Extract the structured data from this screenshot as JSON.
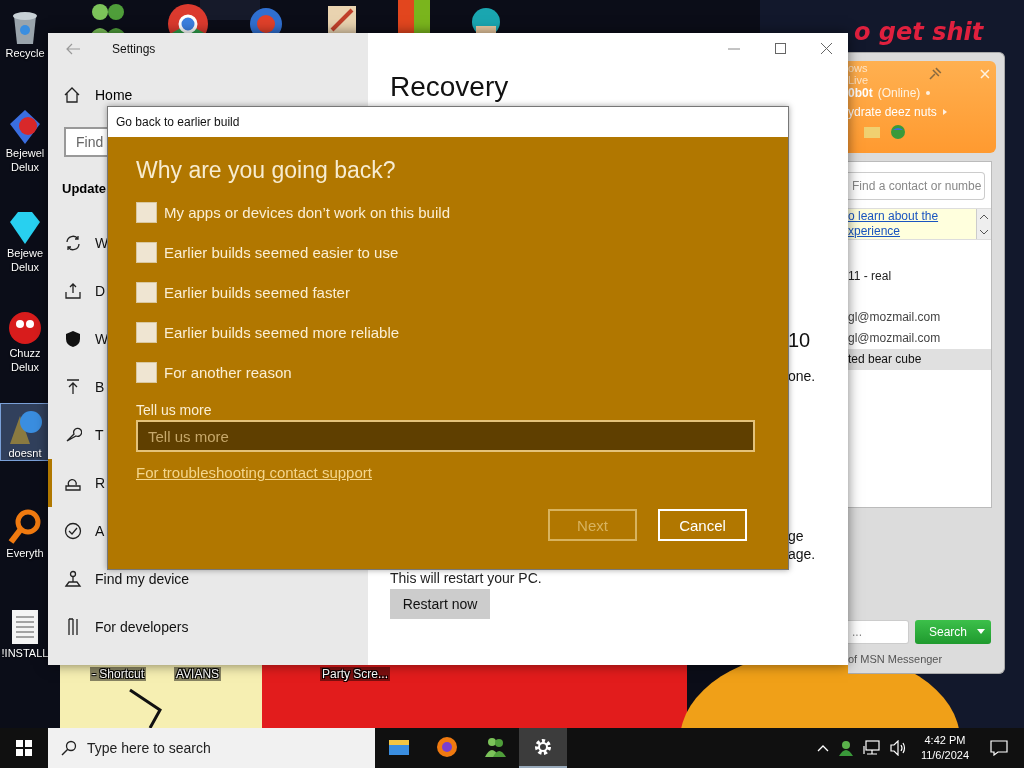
{
  "desktop": {
    "banner_text": "o get shit",
    "icons": [
      {
        "label": "Recycle",
        "selected": false
      },
      {
        "label": "Bejewel Delux",
        "selected": false
      },
      {
        "label": "Bejewe Delux",
        "selected": false
      },
      {
        "label": "Chuzz Delux",
        "selected": false
      },
      {
        "label": "doesnt",
        "selected": true
      },
      {
        "label": "Everyth",
        "selected": false
      },
      {
        "label": "!INSTALL",
        "selected": false
      }
    ],
    "bottom_labels": [
      "- Shortcut",
      "AVIANS",
      "Party Scre..."
    ]
  },
  "settings": {
    "title": "Settings",
    "home": "Home",
    "search_placeholder": "Find",
    "section": "Update",
    "nav": [
      {
        "label": "W",
        "selected": false
      },
      {
        "label": "D",
        "selected": false
      },
      {
        "label": "W",
        "selected": false
      },
      {
        "label": "B",
        "selected": false
      },
      {
        "label": "T",
        "selected": false
      },
      {
        "label": "R",
        "selected": true
      },
      {
        "label": "A",
        "selected": false
      },
      {
        "label": "Find my device",
        "selected": false
      },
      {
        "label": "For developers",
        "selected": false
      }
    ],
    "page_title": "Recovery",
    "fragment_1": "10",
    "fragment_2": "one.",
    "fragment_3": "ge",
    "fragment_4": "age.",
    "restart_note": "This will restart your PC.",
    "restart_button": "Restart now"
  },
  "dialog": {
    "title": "Go back to earlier build",
    "heading": "Why are you going back?",
    "reasons": [
      {
        "label": "My apps or devices don’t work on this build",
        "checked": false
      },
      {
        "label": "Earlier builds seemed easier to use",
        "checked": false
      },
      {
        "label": "Earlier builds seemed faster",
        "checked": false
      },
      {
        "label": "Earlier builds seemed more reliable",
        "checked": false
      },
      {
        "label": "For another reason",
        "checked": false
      }
    ],
    "more_label": "Tell us more",
    "more_placeholder": "Tell us more",
    "support_link": "For troubleshooting contact support",
    "next": {
      "label": "Next",
      "disabled": true
    },
    "cancel": {
      "label": "Cancel",
      "disabled": false
    }
  },
  "messenger": {
    "brand": "ows Live",
    "name": "0b0t",
    "status": "(Online)",
    "personal_message": "ydrate deez nuts",
    "search_placeholder": "Find a contact or numbe",
    "notice_lines": [
      "o learn about the",
      "xperience"
    ],
    "contacts": [
      {
        "label": "11 - real",
        "selected": false
      },
      {
        "label": "gl@mozmail.com",
        "selected": false
      },
      {
        "label": "gl@mozmail.com",
        "selected": false
      },
      {
        "label": "ted bear cube",
        "selected": true
      }
    ],
    "bottom_search": "...",
    "search_button": "Search",
    "footer": "of MSN Messenger"
  },
  "taskbar": {
    "search_placeholder": "Type here to search",
    "apps": [
      {
        "selected": false
      },
      {
        "selected": false
      },
      {
        "selected": false
      },
      {
        "selected": true
      }
    ],
    "time": "4:42 PM",
    "date": "11/6/2024"
  }
}
